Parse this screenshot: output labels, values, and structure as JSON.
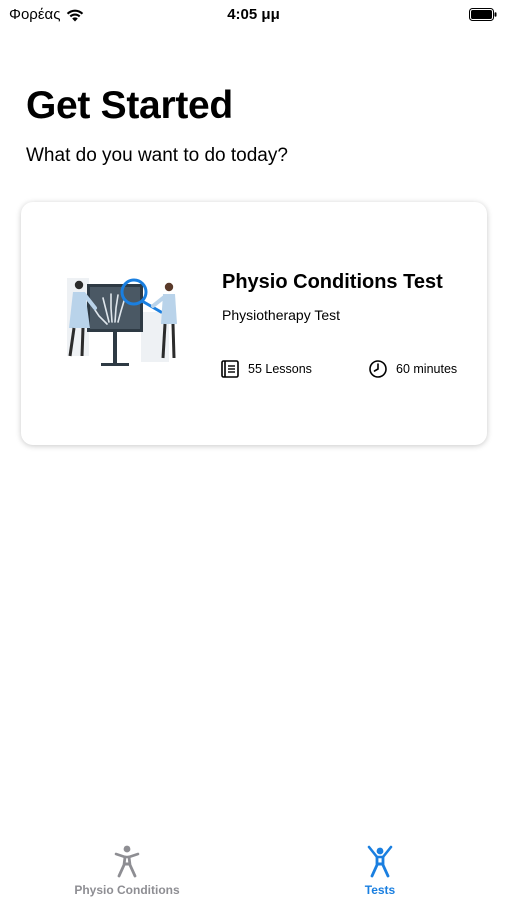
{
  "status_bar": {
    "carrier": "Φορέας",
    "time": "4:05 μμ"
  },
  "header": {
    "title": "Get Started",
    "subtitle": "What do you want to do today?"
  },
  "card": {
    "title": "Physio Conditions Test",
    "subtitle": "Physiotherapy Test",
    "lessons": "55 Lessons",
    "duration": "60 minutes",
    "illustration_icon": "xray-doctors-illustration"
  },
  "tab_bar": {
    "tabs": [
      {
        "label": "Physio Conditions",
        "icon": "person-figure-icon",
        "selected": false
      },
      {
        "label": "Tests",
        "icon": "person-arms-up-icon",
        "selected": true
      }
    ]
  },
  "colors": {
    "accent": "#1a7fe0",
    "inactive": "#8e8e93"
  }
}
